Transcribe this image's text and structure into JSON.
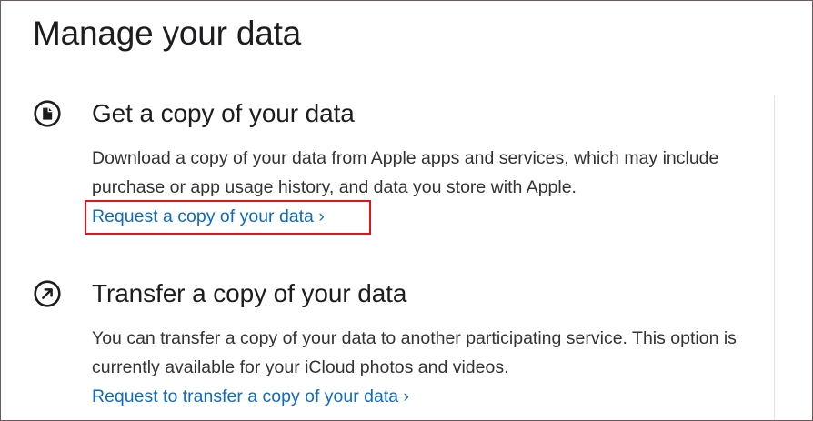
{
  "page": {
    "title": "Manage your data"
  },
  "sections": [
    {
      "icon": "document-icon",
      "heading": "Get a copy of your data",
      "description": "Download a copy of your data from Apple apps and services, which may include purchase or app usage history, and data you store with Apple.",
      "link_label": "Request a copy of your data ›"
    },
    {
      "icon": "arrow-up-right-icon",
      "heading": "Transfer a copy of your data",
      "description": "You can transfer a copy of your data to another participating service. This option is currently available for your iCloud photos and videos.",
      "link_label": "Request to transfer a copy of your data ›"
    }
  ],
  "colors": {
    "link": "#0f6cbd",
    "text": "#1d1d1f",
    "highlight": "#e0141e"
  }
}
